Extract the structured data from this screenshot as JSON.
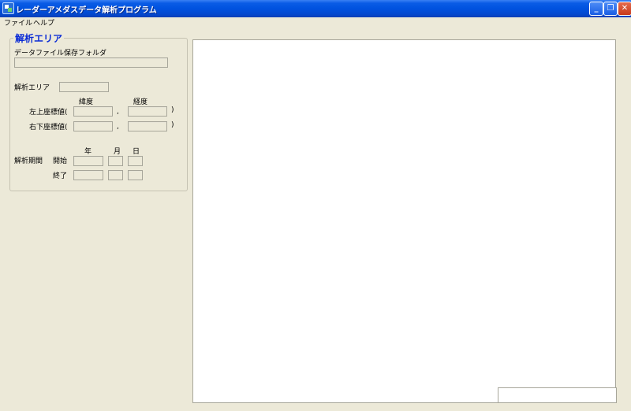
{
  "window": {
    "title": "レーダーアメダスデータ解析プログラム"
  },
  "menu": {
    "items": [
      "ファイル",
      "ヘルプ"
    ]
  },
  "panel": {
    "group_title": "解析エリア",
    "folder_label": "データファイル保存フォルダ",
    "folder_value": "",
    "area_label": "解析エリア",
    "area_value": "",
    "lat_header": "緯度",
    "lon_header": "経度",
    "upper_left_label": "左上座標値(",
    "lower_right_label": "右下座標値(",
    "comma": ",",
    "close_paren": ")",
    "upper_left": {
      "lat": "",
      "lon": ""
    },
    "lower_right": {
      "lat": "",
      "lon": ""
    },
    "period_label": "解析期間",
    "start_label": "開始",
    "end_label": "終了",
    "year_header": "年",
    "month_header": "月",
    "day_header": "日",
    "start": {
      "year": "",
      "month": "",
      "day": ""
    },
    "end": {
      "year": "",
      "month": "",
      "day": ""
    }
  },
  "status": {
    "text": ""
  }
}
